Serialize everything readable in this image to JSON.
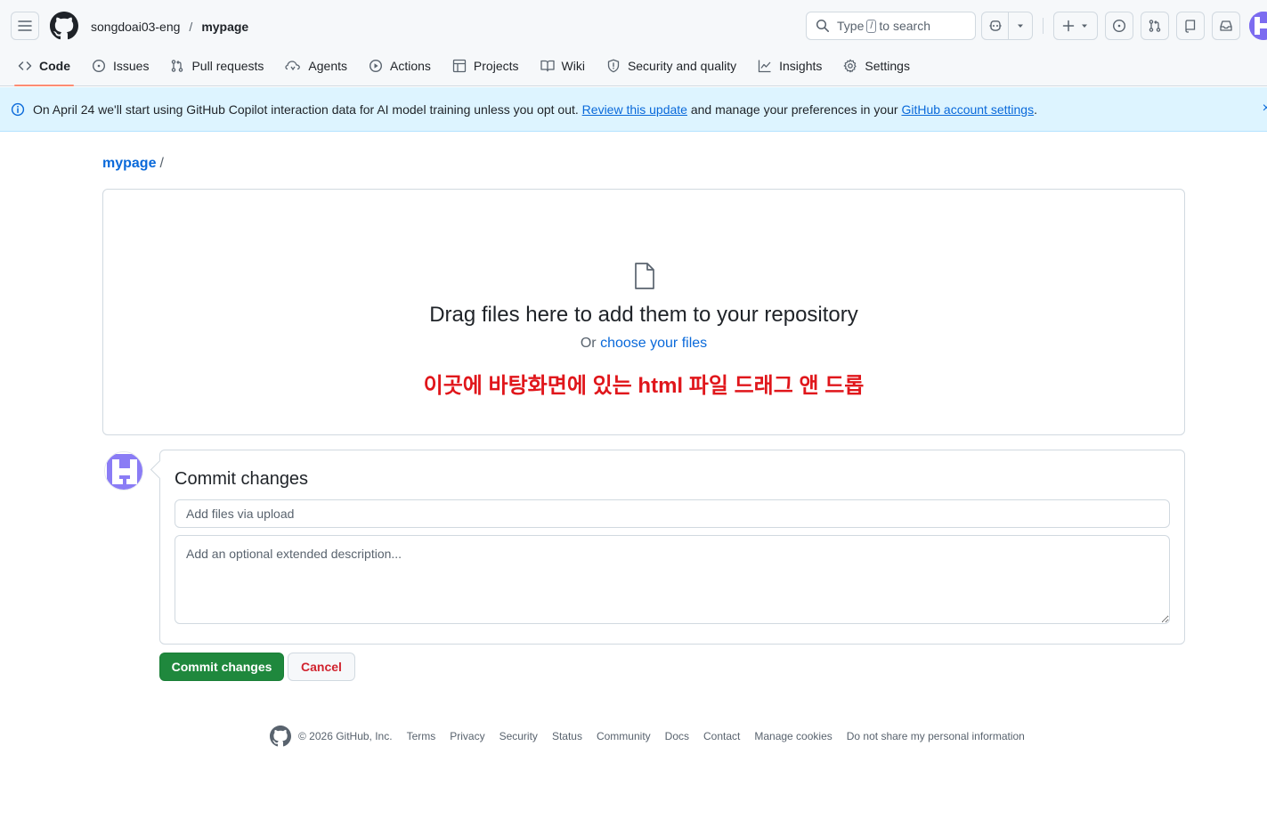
{
  "header": {
    "owner": "songdoai03-eng",
    "separator": "/",
    "repo": "mypage",
    "search": {
      "prefix": "Type",
      "key": "/",
      "suffix": "to search"
    }
  },
  "nav": {
    "tabs": [
      {
        "label": "Code",
        "icon": "code-icon",
        "selected": true
      },
      {
        "label": "Issues",
        "icon": "issue-opened-icon"
      },
      {
        "label": "Pull requests",
        "icon": "git-pull-request-icon"
      },
      {
        "label": "Agents",
        "icon": "agent-icon"
      },
      {
        "label": "Actions",
        "icon": "play-icon"
      },
      {
        "label": "Projects",
        "icon": "table-icon"
      },
      {
        "label": "Wiki",
        "icon": "book-icon"
      },
      {
        "label": "Security and quality",
        "icon": "shield-icon"
      },
      {
        "label": "Insights",
        "icon": "graph-icon"
      },
      {
        "label": "Settings",
        "icon": "gear-icon"
      }
    ]
  },
  "banner": {
    "text_before": "On April 24 we'll start using GitHub Copilot interaction data for AI model training unless you opt out.",
    "link1": "Review this update",
    "text_middle": "and manage your preferences in your",
    "link2": "GitHub account settings",
    "text_after": ".",
    "close": "×"
  },
  "breadcrumb": {
    "repo": "mypage",
    "slash": "/"
  },
  "dropzone": {
    "title": "Drag files here to add them to your repository",
    "or": "Or",
    "choose": "choose your files",
    "annotation": "이곳에 바탕화면에 있는 html 파일 드래그 앤 드롭"
  },
  "commit": {
    "title": "Commit changes",
    "summary_placeholder": "Add files via upload",
    "description_placeholder": "Add an optional extended description...",
    "commit_button": "Commit changes",
    "cancel_button": "Cancel"
  },
  "footer": {
    "copyright": "© 2026 GitHub, Inc.",
    "links": [
      "Terms",
      "Privacy",
      "Security",
      "Status",
      "Community",
      "Docs",
      "Contact",
      "Manage cookies",
      "Do not share my personal information"
    ]
  },
  "colors": {
    "link": "#0969da",
    "primary_button": "#1f883d",
    "danger_text": "#d1242f",
    "annotation": "#e0161b",
    "banner_bg": "#ddf4ff",
    "tab_underline": "#fd8c73"
  }
}
